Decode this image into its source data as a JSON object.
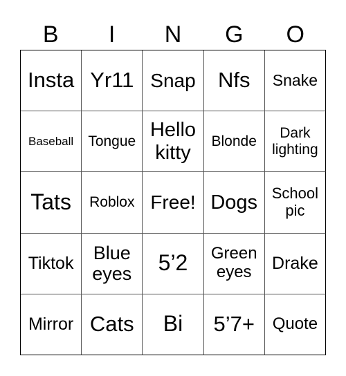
{
  "header": {
    "letters": [
      "B",
      "I",
      "N",
      "G",
      "O"
    ]
  },
  "grid": {
    "cells": [
      [
        "Insta",
        "Yr11",
        "Snap",
        "Nfs",
        "Snake"
      ],
      [
        "Baseball",
        "Tongue",
        "Hello kitty",
        "Blonde",
        "Dark lighting"
      ],
      [
        "Tats",
        "Roblox",
        "Free!",
        "Dogs",
        "School pic"
      ],
      [
        "Tiktok",
        "Blue eyes",
        "5’2",
        "Green eyes",
        "Drake"
      ],
      [
        "Mirror",
        "Cats",
        "Bi",
        "5’7+",
        "Quote"
      ]
    ],
    "font_sizes": [
      [
        31,
        31,
        28,
        31,
        23
      ],
      [
        17,
        21,
        29,
        21,
        21
      ],
      [
        32,
        21,
        28,
        29,
        22
      ],
      [
        25,
        27,
        32,
        24,
        25
      ],
      [
        25,
        31,
        32,
        31,
        24
      ]
    ]
  }
}
